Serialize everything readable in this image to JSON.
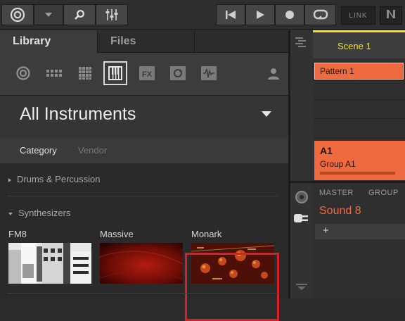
{
  "toolbar": {
    "link_label": "LINK",
    "icons": [
      "maschine-logo-icon",
      "dropdown-arrow-icon",
      "search-icon",
      "mixer-icon",
      "skip-back-icon",
      "play-icon",
      "record-icon",
      "loop-icon",
      "ni-logo-icon"
    ]
  },
  "browser": {
    "tabs": [
      {
        "label": "Library"
      },
      {
        "label": "Files"
      }
    ],
    "file_type_icons": [
      "project-icon",
      "group-icon",
      "sound-icon",
      "instrument-icon",
      "effect-icon",
      "loop-icon",
      "one-shot-icon",
      "user-icon"
    ],
    "selected_type": "instrument-icon",
    "header_title": "All Instruments",
    "filters": {
      "category_label": "Category",
      "vendor_label": "Vendor"
    },
    "groups": [
      {
        "label": "Drums & Percussion",
        "expanded": false
      },
      {
        "label": "Synthesizers",
        "expanded": true
      }
    ],
    "tiles": [
      {
        "label": "FM8"
      },
      {
        "label": "Massive"
      },
      {
        "label": "Monark",
        "highlighted": true
      }
    ]
  },
  "arranger": {
    "scene_label": "Scene 1",
    "pattern_label": "Pattern 1",
    "group_name": "A1",
    "group_sub": "Group A1"
  },
  "sound_panel": {
    "tabs": [
      "MASTER",
      "GROUP"
    ],
    "sound_name": "Sound 8",
    "add_label": "+"
  },
  "colors": {
    "accent_orange": "#ef6a3e",
    "scene_yellow": "#f2e21e",
    "highlight_red": "#d9202a"
  }
}
